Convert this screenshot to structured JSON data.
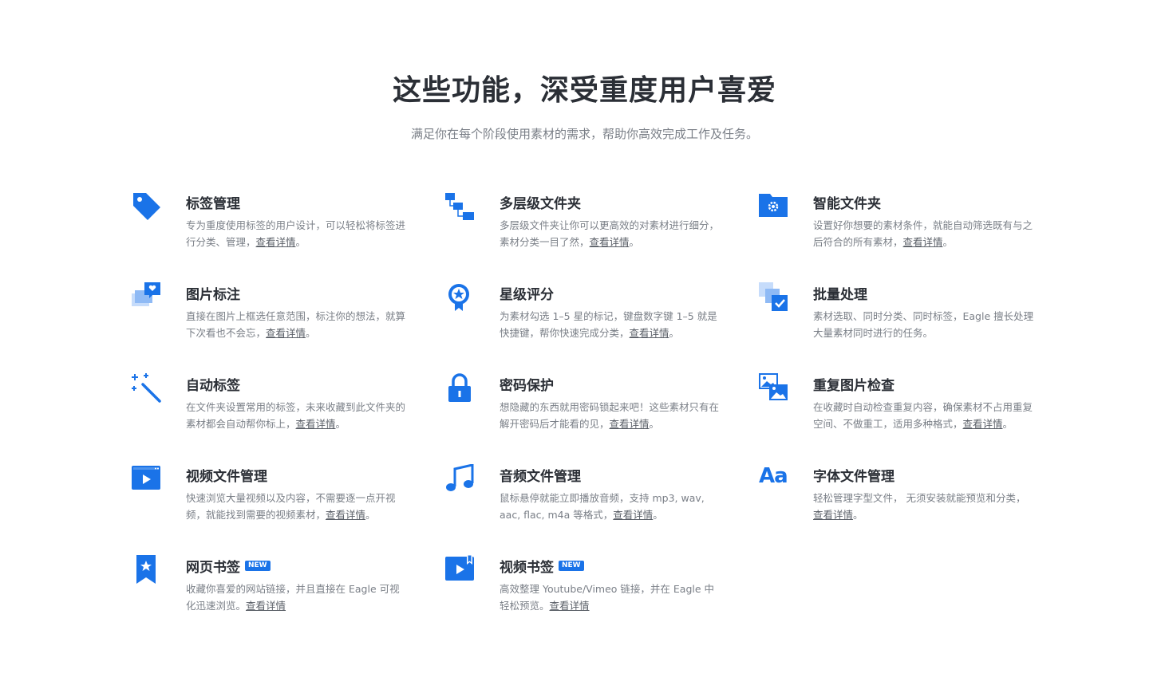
{
  "header": {
    "title": "这些功能，深受重度用户喜爱",
    "subtitle": "满足你在每个阶段使用素材的需求，帮助你高效完成工作及任务。"
  },
  "colors": {
    "accent": "#1a73e8",
    "text": "#2b2f36",
    "muted": "#7a7f87"
  },
  "features": [
    {
      "title": "标签管理",
      "icon": "tag-icon",
      "desc": "专为重度使用标签的用户设计，可以轻松将标签进行分类、管理，",
      "link": "查看详情",
      "tail": "。",
      "badge": ""
    },
    {
      "title": "多层级文件夹",
      "icon": "folder-tree-icon",
      "desc": "多层级文件夹让你可以更高效的对素材进行细分，素材分类一目了然，",
      "link": "查看详情",
      "tail": "。",
      "badge": ""
    },
    {
      "title": "智能文件夹",
      "icon": "smart-folder-icon",
      "desc": "设置好你想要的素材条件，就能自动筛选既有与之后符合的所有素材，",
      "link": "查看详情",
      "tail": "。",
      "badge": ""
    },
    {
      "title": "图片标注",
      "icon": "image-annotation-icon",
      "desc": "直接在图片上框选任意范围，标注你的想法，就算下次看也不会忘，",
      "link": "查看详情",
      "tail": "。",
      "badge": ""
    },
    {
      "title": "星级评分",
      "icon": "rating-badge-icon",
      "desc": "为素材勾选 1–5 星的标记，键盘数字键 1–5 就是快捷键，帮你快速完成分类，",
      "link": "查看详情",
      "tail": "。",
      "badge": ""
    },
    {
      "title": "批量处理",
      "icon": "batch-icon",
      "desc": "素材选取、同时分类、同时标签，Eagle 擅长处理大量素材同时进行的任务。",
      "link": "",
      "tail": "",
      "badge": ""
    },
    {
      "title": "自动标签",
      "icon": "magic-wand-icon",
      "desc": "在文件夹设置常用的标签，未来收藏到此文件夹的素材都会自动帮你标上，",
      "link": "查看详情",
      "tail": "。",
      "badge": ""
    },
    {
      "title": "密码保护",
      "icon": "lock-icon",
      "desc": "想隐藏的东西就用密码锁起来吧！这些素材只有在解开密码后才能看的见，",
      "link": "查看详情",
      "tail": "。",
      "badge": ""
    },
    {
      "title": "重复图片检查",
      "icon": "duplicate-images-icon",
      "desc": "在收藏时自动检查重复内容，确保素材不占用重复空间、不做重工，适用多种格式，",
      "link": "查看详情",
      "tail": "。",
      "badge": ""
    },
    {
      "title": "视频文件管理",
      "icon": "video-file-icon",
      "desc": "快速浏览大量视频以及内容，不需要逐一点开视频，就能找到需要的视频素材，",
      "link": "查看详情",
      "tail": "。",
      "badge": ""
    },
    {
      "title": "音频文件管理",
      "icon": "music-note-icon",
      "desc": "鼠标悬停就能立即播放音频，支持 mp3, wav, aac, flac, m4a 等格式，",
      "link": "查看详情",
      "tail": "。",
      "badge": ""
    },
    {
      "title": "字体文件管理",
      "icon": "font-icon",
      "desc": "轻松管理字型文件， 无须安装就能预览和分类，",
      "link": "查看详情",
      "tail": "。",
      "badge": "",
      "iconText": "Aa"
    },
    {
      "title": "网页书签",
      "icon": "bookmark-icon",
      "desc": "收藏你喜爱的网站链接，并且直接在 Eagle 可视化迅速浏览。",
      "link": "查看详情",
      "tail": "",
      "badge": "NEW"
    },
    {
      "title": "视频书签",
      "icon": "video-bookmark-icon",
      "desc": "高效整理 Youtube/Vimeo 链接，并在 Eagle 中轻松预览。",
      "link": "查看详情",
      "tail": "",
      "badge": "NEW"
    }
  ]
}
